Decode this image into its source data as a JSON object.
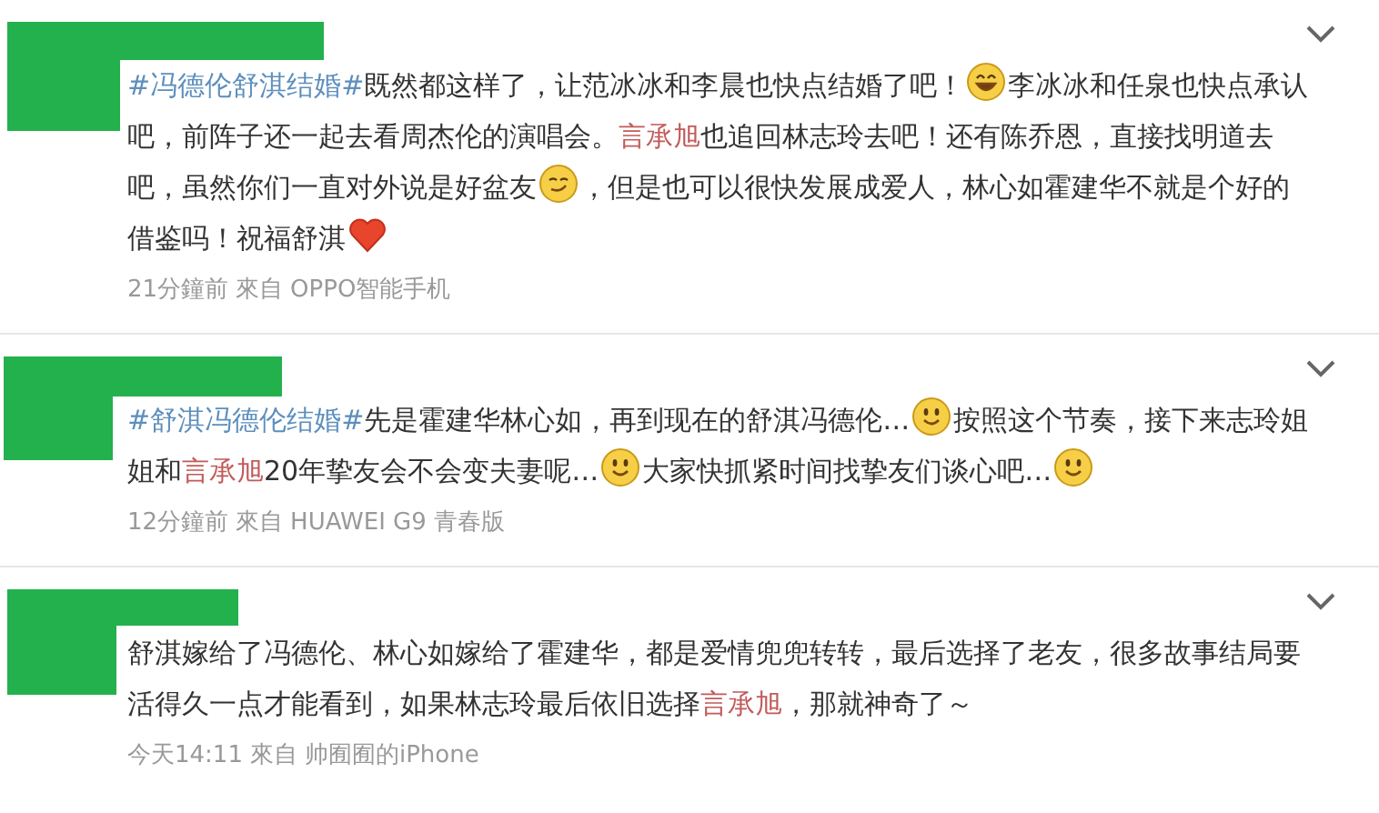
{
  "comments": [
    {
      "runs": [
        {
          "kind": "hashtag",
          "text": "#冯德伦舒淇结婚#"
        },
        {
          "kind": "text",
          "text": "既然都这样了，让范冰冰和李晨也快点结婚了吧！"
        },
        {
          "kind": "laugh"
        },
        {
          "kind": "text",
          "text": "李冰冰和任泉也快点承认吧，前阵子还一起去看周杰伦的演唱会。"
        },
        {
          "kind": "mention",
          "text": "言承旭"
        },
        {
          "kind": "text",
          "text": "也追回林志玲去吧！还有陈乔恩，直接找明道去吧，虽然你们一直对外说是好盆友"
        },
        {
          "kind": "smirk"
        },
        {
          "kind": "text",
          "text": "，但是也可以很快发展成爱人，林心如霍建华不就是个好的借鉴吗！祝福舒淇"
        },
        {
          "kind": "heart"
        }
      ],
      "time": "21分鐘前",
      "from": "來自",
      "device": "OPPO智能手机"
    },
    {
      "runs": [
        {
          "kind": "hashtag",
          "text": "#舒淇冯德伦结婚#"
        },
        {
          "kind": "text",
          "text": "先是霍建华林心如，再到现在的舒淇冯德伦…"
        },
        {
          "kind": "smile"
        },
        {
          "kind": "text",
          "text": "按照这个节奏，接下来志玲姐姐和"
        },
        {
          "kind": "mention",
          "text": "言承旭"
        },
        {
          "kind": "text",
          "text": "20年挚友会不会变夫妻呢…"
        },
        {
          "kind": "smile"
        },
        {
          "kind": "text",
          "text": "大家快抓紧时间找挚友们谈心吧…"
        },
        {
          "kind": "smile"
        }
      ],
      "time": "12分鐘前",
      "from": "來自",
      "device": "HUAWEI G9 青春版"
    },
    {
      "runs": [
        {
          "kind": "text",
          "text": "舒淇嫁给了冯德伦、林心如嫁给了霍建华，都是爱情兜兜转转，最后选择了老友，很多故事结局要活得久一点才能看到，如果林志玲最后依旧选择"
        },
        {
          "kind": "mention",
          "text": "言承旭"
        },
        {
          "kind": "text",
          "text": "，那就神奇了～"
        }
      ],
      "time": "今天14:11",
      "from": "來自",
      "device": "帅囿囿的iPhone"
    }
  ]
}
